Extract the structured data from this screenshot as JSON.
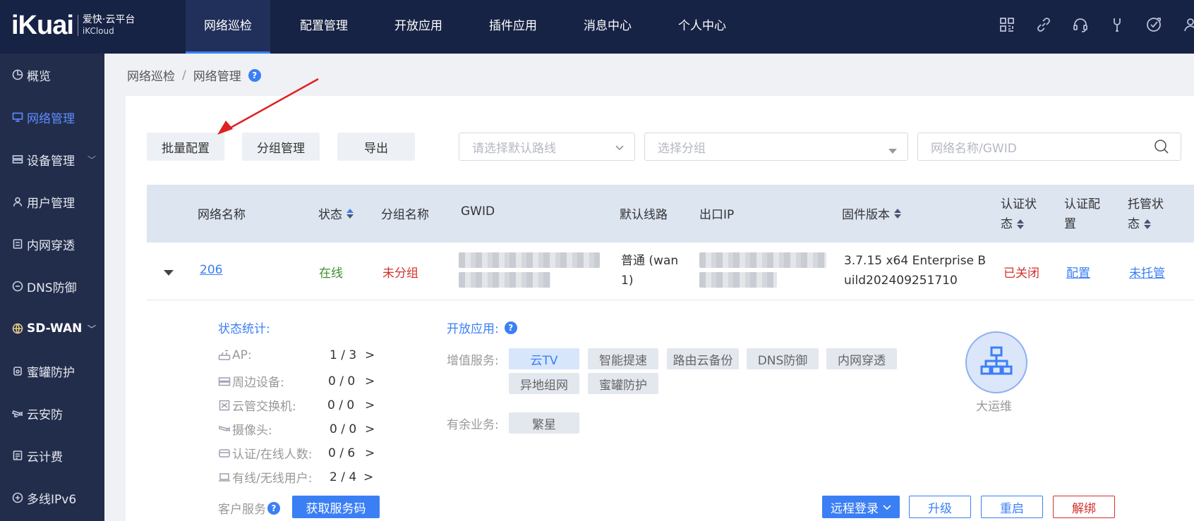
{
  "brand": {
    "logo": "iKuai",
    "name_cn": "爱快·云平台",
    "name_en": "iKCloud"
  },
  "topnav": [
    "网络巡检",
    "配置管理",
    "开放应用",
    "插件应用",
    "消息中心",
    "个人中心"
  ],
  "top_icons": [
    "grid-icon",
    "link-icon",
    "headset-icon",
    "tool-icon",
    "upgrade-icon",
    "user-icon"
  ],
  "sidebar": [
    {
      "label": "概览",
      "icon": "pie-chart-icon"
    },
    {
      "label": "网络管理",
      "icon": "monitor-icon"
    },
    {
      "label": "设备管理",
      "icon": "device-icon"
    },
    {
      "label": "用户管理",
      "icon": "user-icon"
    },
    {
      "label": "内网穿透",
      "icon": "tunnel-icon"
    },
    {
      "label": "DNS防御",
      "icon": "shield-icon"
    },
    {
      "label": "SD-WAN",
      "icon": "globe-icon"
    },
    {
      "label": "蜜罐防护",
      "icon": "honeypot-icon"
    },
    {
      "label": "云安防",
      "icon": "camera-icon"
    },
    {
      "label": "云计费",
      "icon": "billing-icon"
    },
    {
      "label": "多线IPv6",
      "icon": "ipv6-icon"
    }
  ],
  "breadcrumb": [
    "网络巡检",
    "网络管理"
  ],
  "breadcrumb_sep": "/",
  "help": "?",
  "toolbar": {
    "batch_config": "批量配置",
    "group_manage": "分组管理",
    "export": "导出",
    "route_placeholder": "请选择默认路线",
    "group_placeholder": "选择分组",
    "search_placeholder": "网络名称/GWID"
  },
  "table": {
    "headers": {
      "name": "网络名称",
      "status": "状态",
      "group": "分组名称",
      "gwid": "GWID",
      "route": "默认线路",
      "exit_ip": "出口IP",
      "firmware": "固件版本",
      "auth_status": [
        "认证状",
        "态"
      ],
      "auth_config": [
        "认证配",
        "置"
      ],
      "hosting": [
        "托管状",
        "态"
      ]
    },
    "row": {
      "name": "206",
      "status": "在线",
      "group": "未分组",
      "route": [
        "普通 (wan",
        "1)"
      ],
      "firmware": [
        "3.7.15 x64 Enterprise B",
        "uild202409251710"
      ],
      "auth_status": "已关闭",
      "auth_config": "配置",
      "hosting": "未托管"
    }
  },
  "details": {
    "stats_title": "状态统计:",
    "stats": [
      {
        "label": "AP:",
        "value": "1 / 3",
        "icon": "router-icon"
      },
      {
        "label": "周边设备:",
        "value": "0 / 0",
        "icon": "device-icon"
      },
      {
        "label": "云管交换机:",
        "value": "0 / 0",
        "icon": "switch-icon"
      },
      {
        "label": "摄像头:",
        "value": "0 / 0",
        "icon": "camera-icon"
      },
      {
        "label": "认证/在线人数:",
        "value": "0 / 6",
        "icon": "card-icon"
      },
      {
        "label": "有线/无线用户:",
        "value": "2 / 4",
        "icon": "laptop-icon"
      }
    ],
    "arrow": ">",
    "apps_title": "开放应用:",
    "value_added_label": "增值服务:",
    "value_added": [
      "云TV",
      "智能提速",
      "路由云备份",
      "DNS防御",
      "内网穿透",
      "异地组网",
      "蜜罐防护"
    ],
    "surplus_label": "有余业务:",
    "surplus": [
      "繁星"
    ],
    "ops_label": "大运维",
    "customer_service_label": "客户服务",
    "get_code": "获取服务码",
    "remote_login": "远程登录",
    "upgrade": "升级",
    "reboot": "重启",
    "unbind": "解绑"
  },
  "colors": {
    "accent": "#3b7ff5",
    "topbar": "#172344",
    "sidebar": "#222d4b",
    "danger": "#d2322d",
    "online": "#3f8f2e"
  }
}
